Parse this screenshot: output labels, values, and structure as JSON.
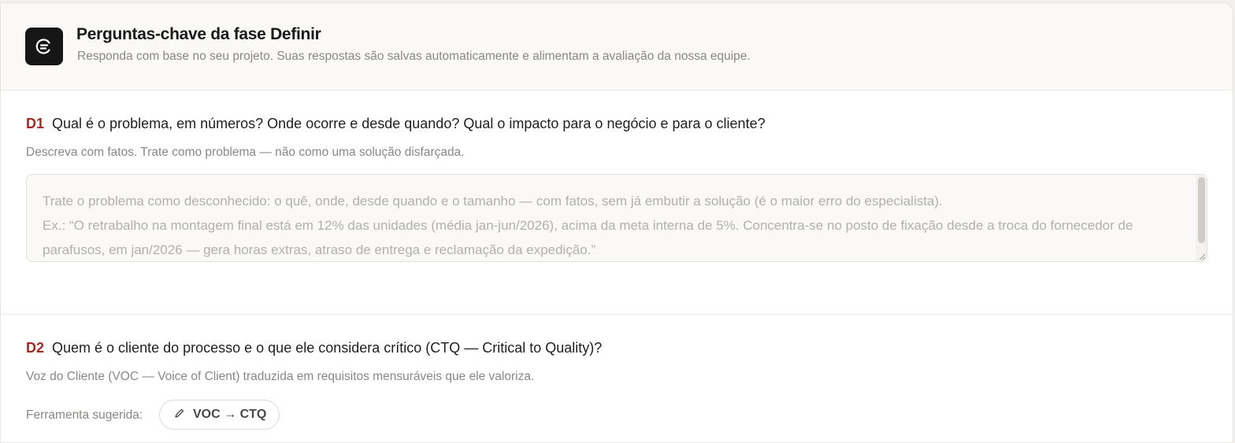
{
  "header": {
    "title": "Perguntas-chave da fase Definir",
    "subtitle": "Responda com base no seu projeto. Suas respostas são salvas automaticamente e alimentam a avaliação da nossa equipe.",
    "logo_icon": "brand-logo-icon"
  },
  "questions": [
    {
      "code": "D1",
      "label": "Qual é o problema, em números? Onde ocorre e desde quando? Qual o impacto para o negócio e para o cliente?",
      "help": "Descreva com fatos. Trate como problema — não como uma solução disfarçada.",
      "answer_value": "",
      "answer_placeholder": "Trate o problema como desconhecido: o quê, onde, desde quando e o tamanho — com fatos, sem já embutir a solução (é o maior erro do especialista).\nEx.: “O retrabalho na montagem final está em 12% das unidades (média jan-jun/2026), acima da meta interna de 5%. Concentra-se no posto de fixação desde a troca do fornecedor de parafusos, em jan/2026 — gera horas extras, atraso de entrega e reclamação da expedição.”"
    },
    {
      "code": "D2",
      "label": "Quem é o cliente do processo e o que ele considera crítico (CTQ — Critical to Quality)?",
      "help": "Voz do Cliente (VOC — Voice of Client) traduzida em requisitos mensuráveis que ele valoriza.",
      "tool_label": "Ferramenta sugerida:",
      "tool_chip": "VOC → CTQ",
      "tool_icon": "pencil-icon"
    }
  ],
  "colors": {
    "accent": "#a52a22",
    "logo_bg": "#161616"
  }
}
